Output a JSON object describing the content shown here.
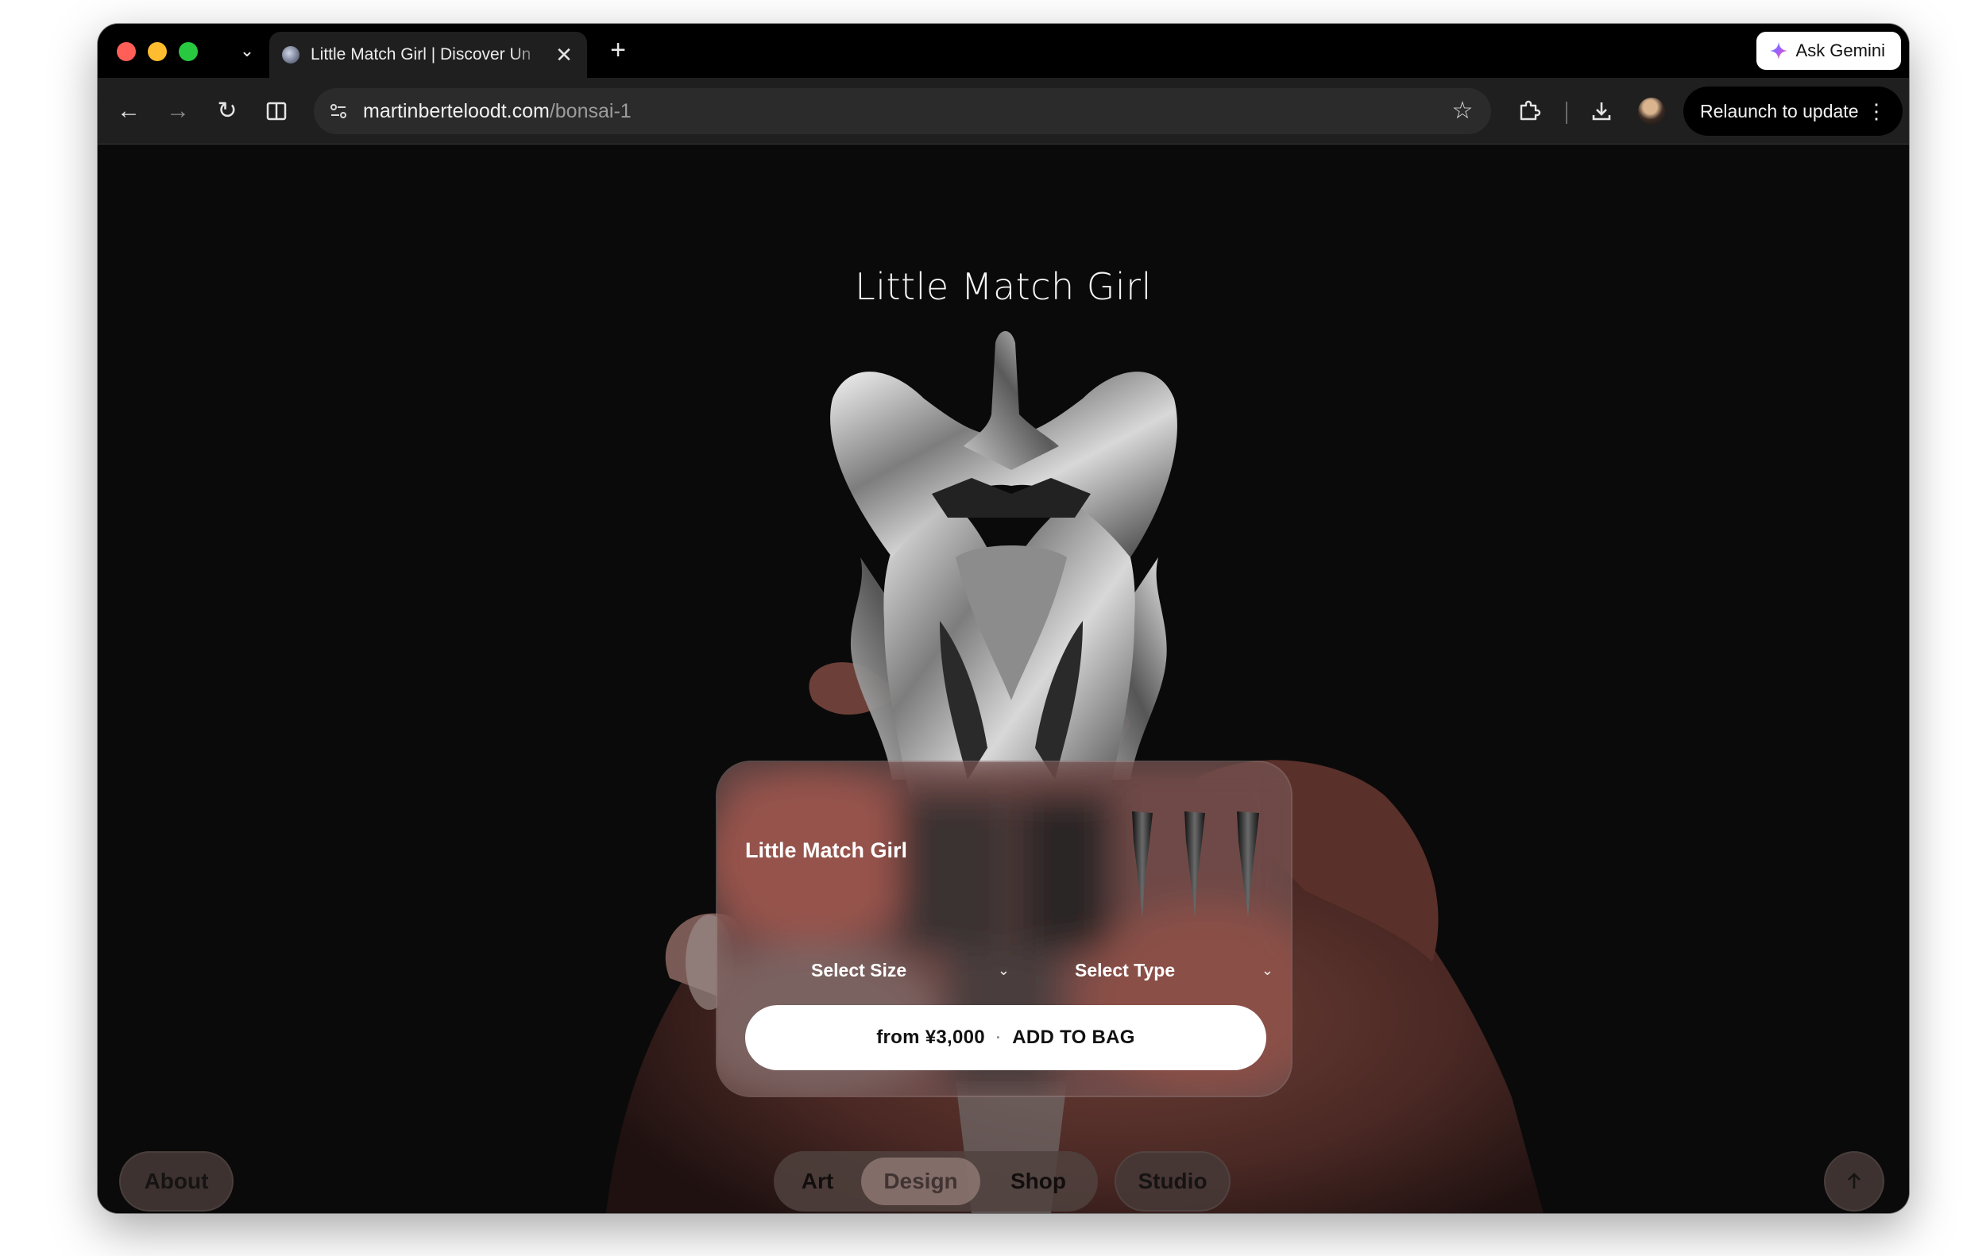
{
  "browser": {
    "tab_title": "Little Match Girl | Discover Un",
    "tab_close": "✕",
    "new_tab": "+",
    "ask_gemini": "Ask Gemini",
    "url_host": "martinberteloodt.com",
    "url_path": "/bonsai-1",
    "relaunch": "Relaunch to update",
    "colors": {
      "close": "#ff5f57",
      "minimize": "#febc2e",
      "maximize": "#28c840"
    }
  },
  "page": {
    "title": "Little Match Girl"
  },
  "product_card": {
    "name": "Little Match Girl",
    "size_select": "Select Size",
    "type_select": "Select Type",
    "price": "from ¥3,000",
    "separator": "·",
    "add_to_bag": "ADD TO BAG"
  },
  "nav": {
    "about": "About",
    "art": "Art",
    "design": "Design",
    "shop": "Shop",
    "studio": "Studio",
    "scroll_top_icon": "arrow-up-icon"
  }
}
